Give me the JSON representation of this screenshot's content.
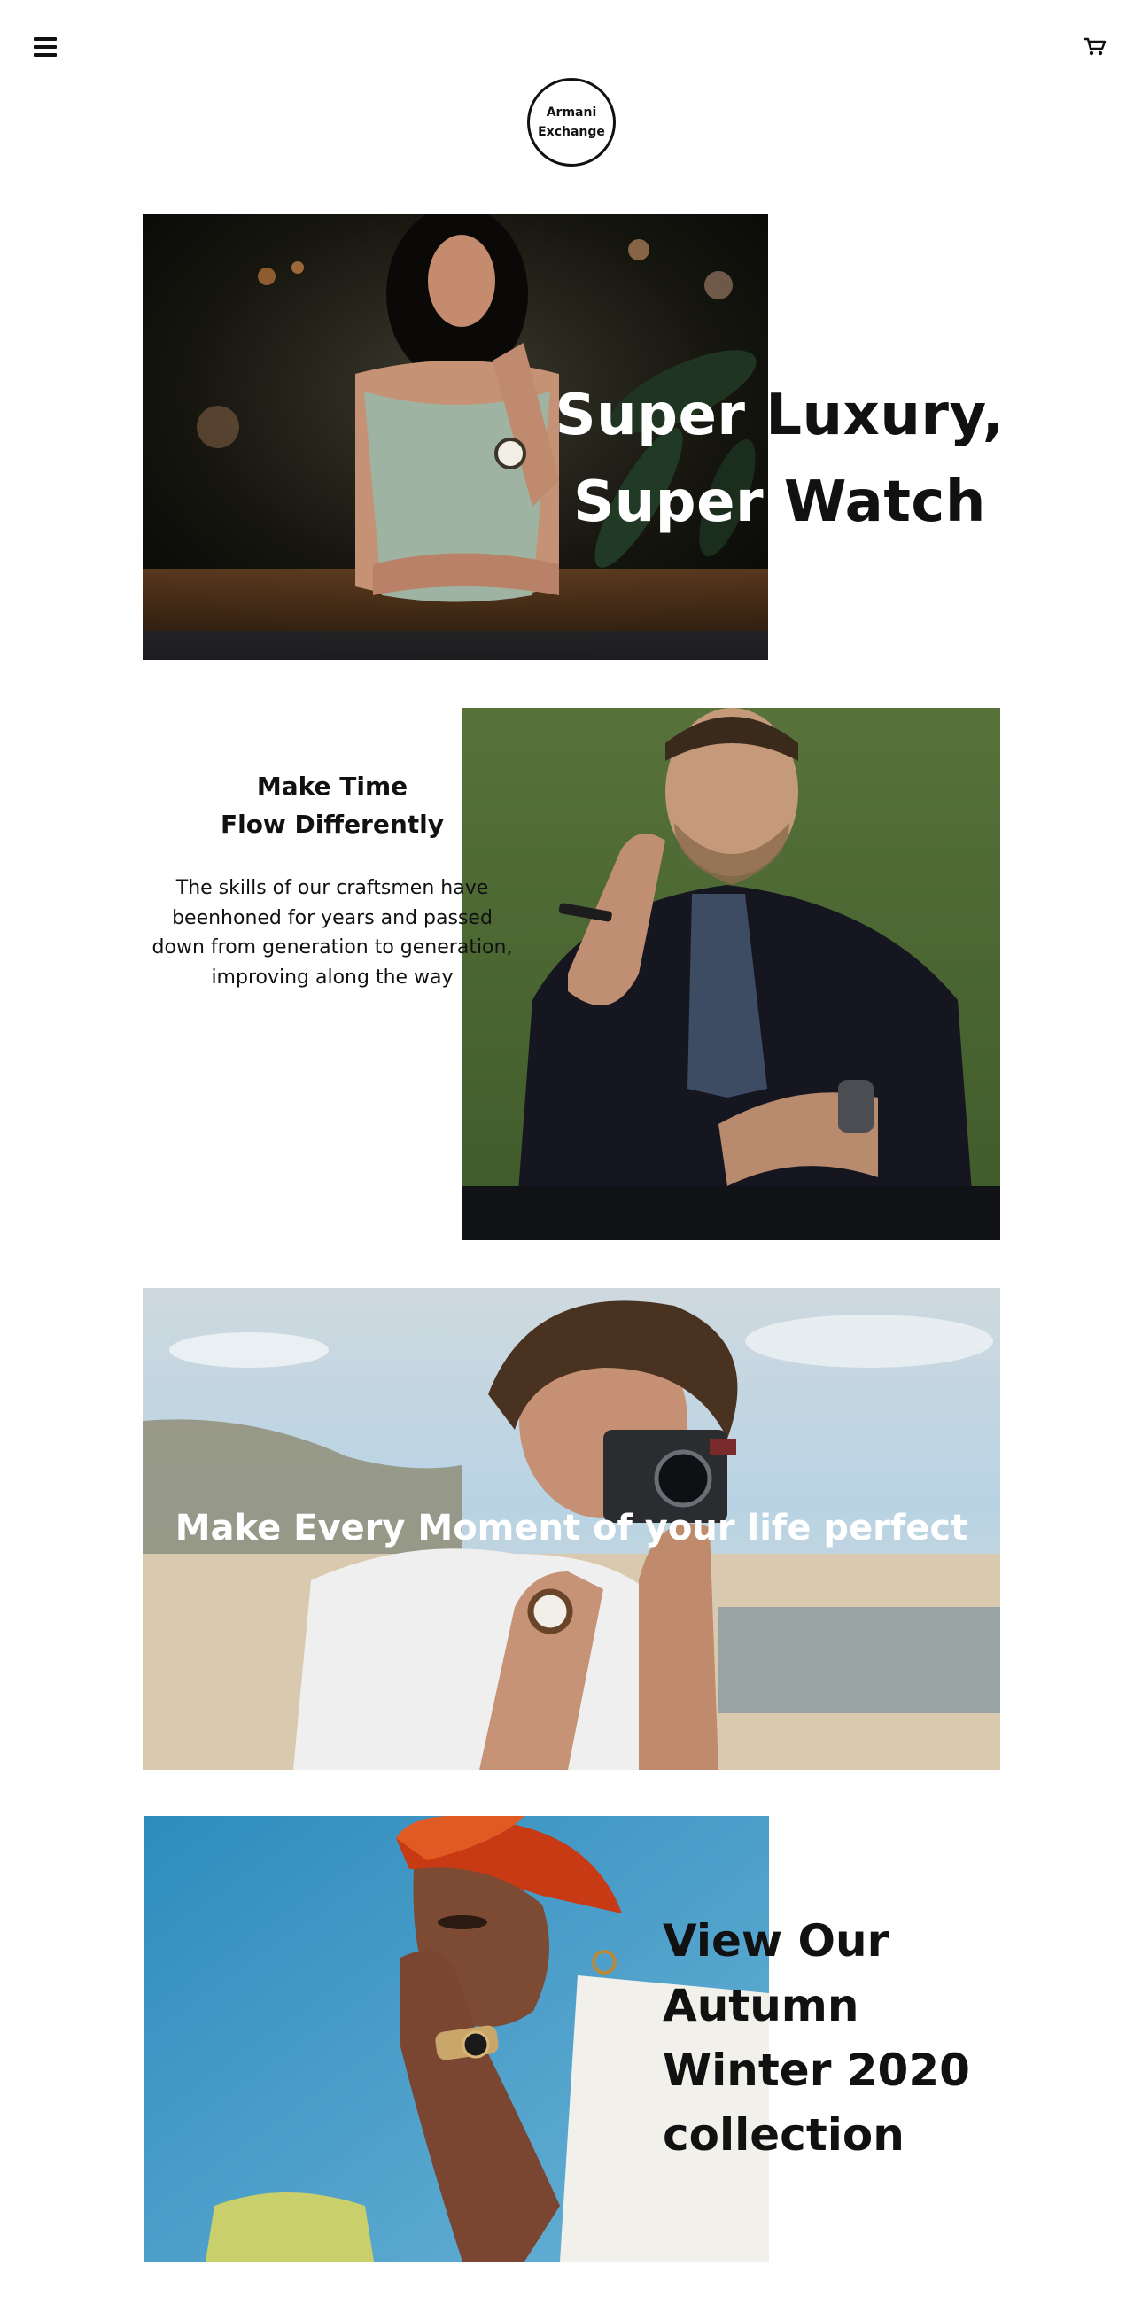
{
  "header": {
    "menu_icon": "hamburger-menu-icon",
    "cart_icon": "shopping-cart-icon",
    "logo_line1": "Armani",
    "logo_line2": "Exchange"
  },
  "section1": {
    "title_part1": "Super",
    "title_part2": "Luxury,",
    "title_part3": "Super",
    "title_part4": "Watch"
  },
  "section2": {
    "heading_line1": "Make Time",
    "heading_line2": "Flow Differently",
    "body_line1": "The skills of our craftsmen have",
    "body_line2": "beenhoned for years and passed",
    "body_line3": "down from generation to generation,",
    "body_line4": "improving along the way"
  },
  "section3": {
    "title": "Make Every Moment of your life perfect"
  },
  "section4": {
    "title_line1": "View Our",
    "title_line2": "Autumn",
    "title_line3": "Winter 2020",
    "title_line4": "collection"
  },
  "colors": {
    "text": "#111111",
    "background": "#ffffff",
    "overlay_text": "#ffffff"
  }
}
